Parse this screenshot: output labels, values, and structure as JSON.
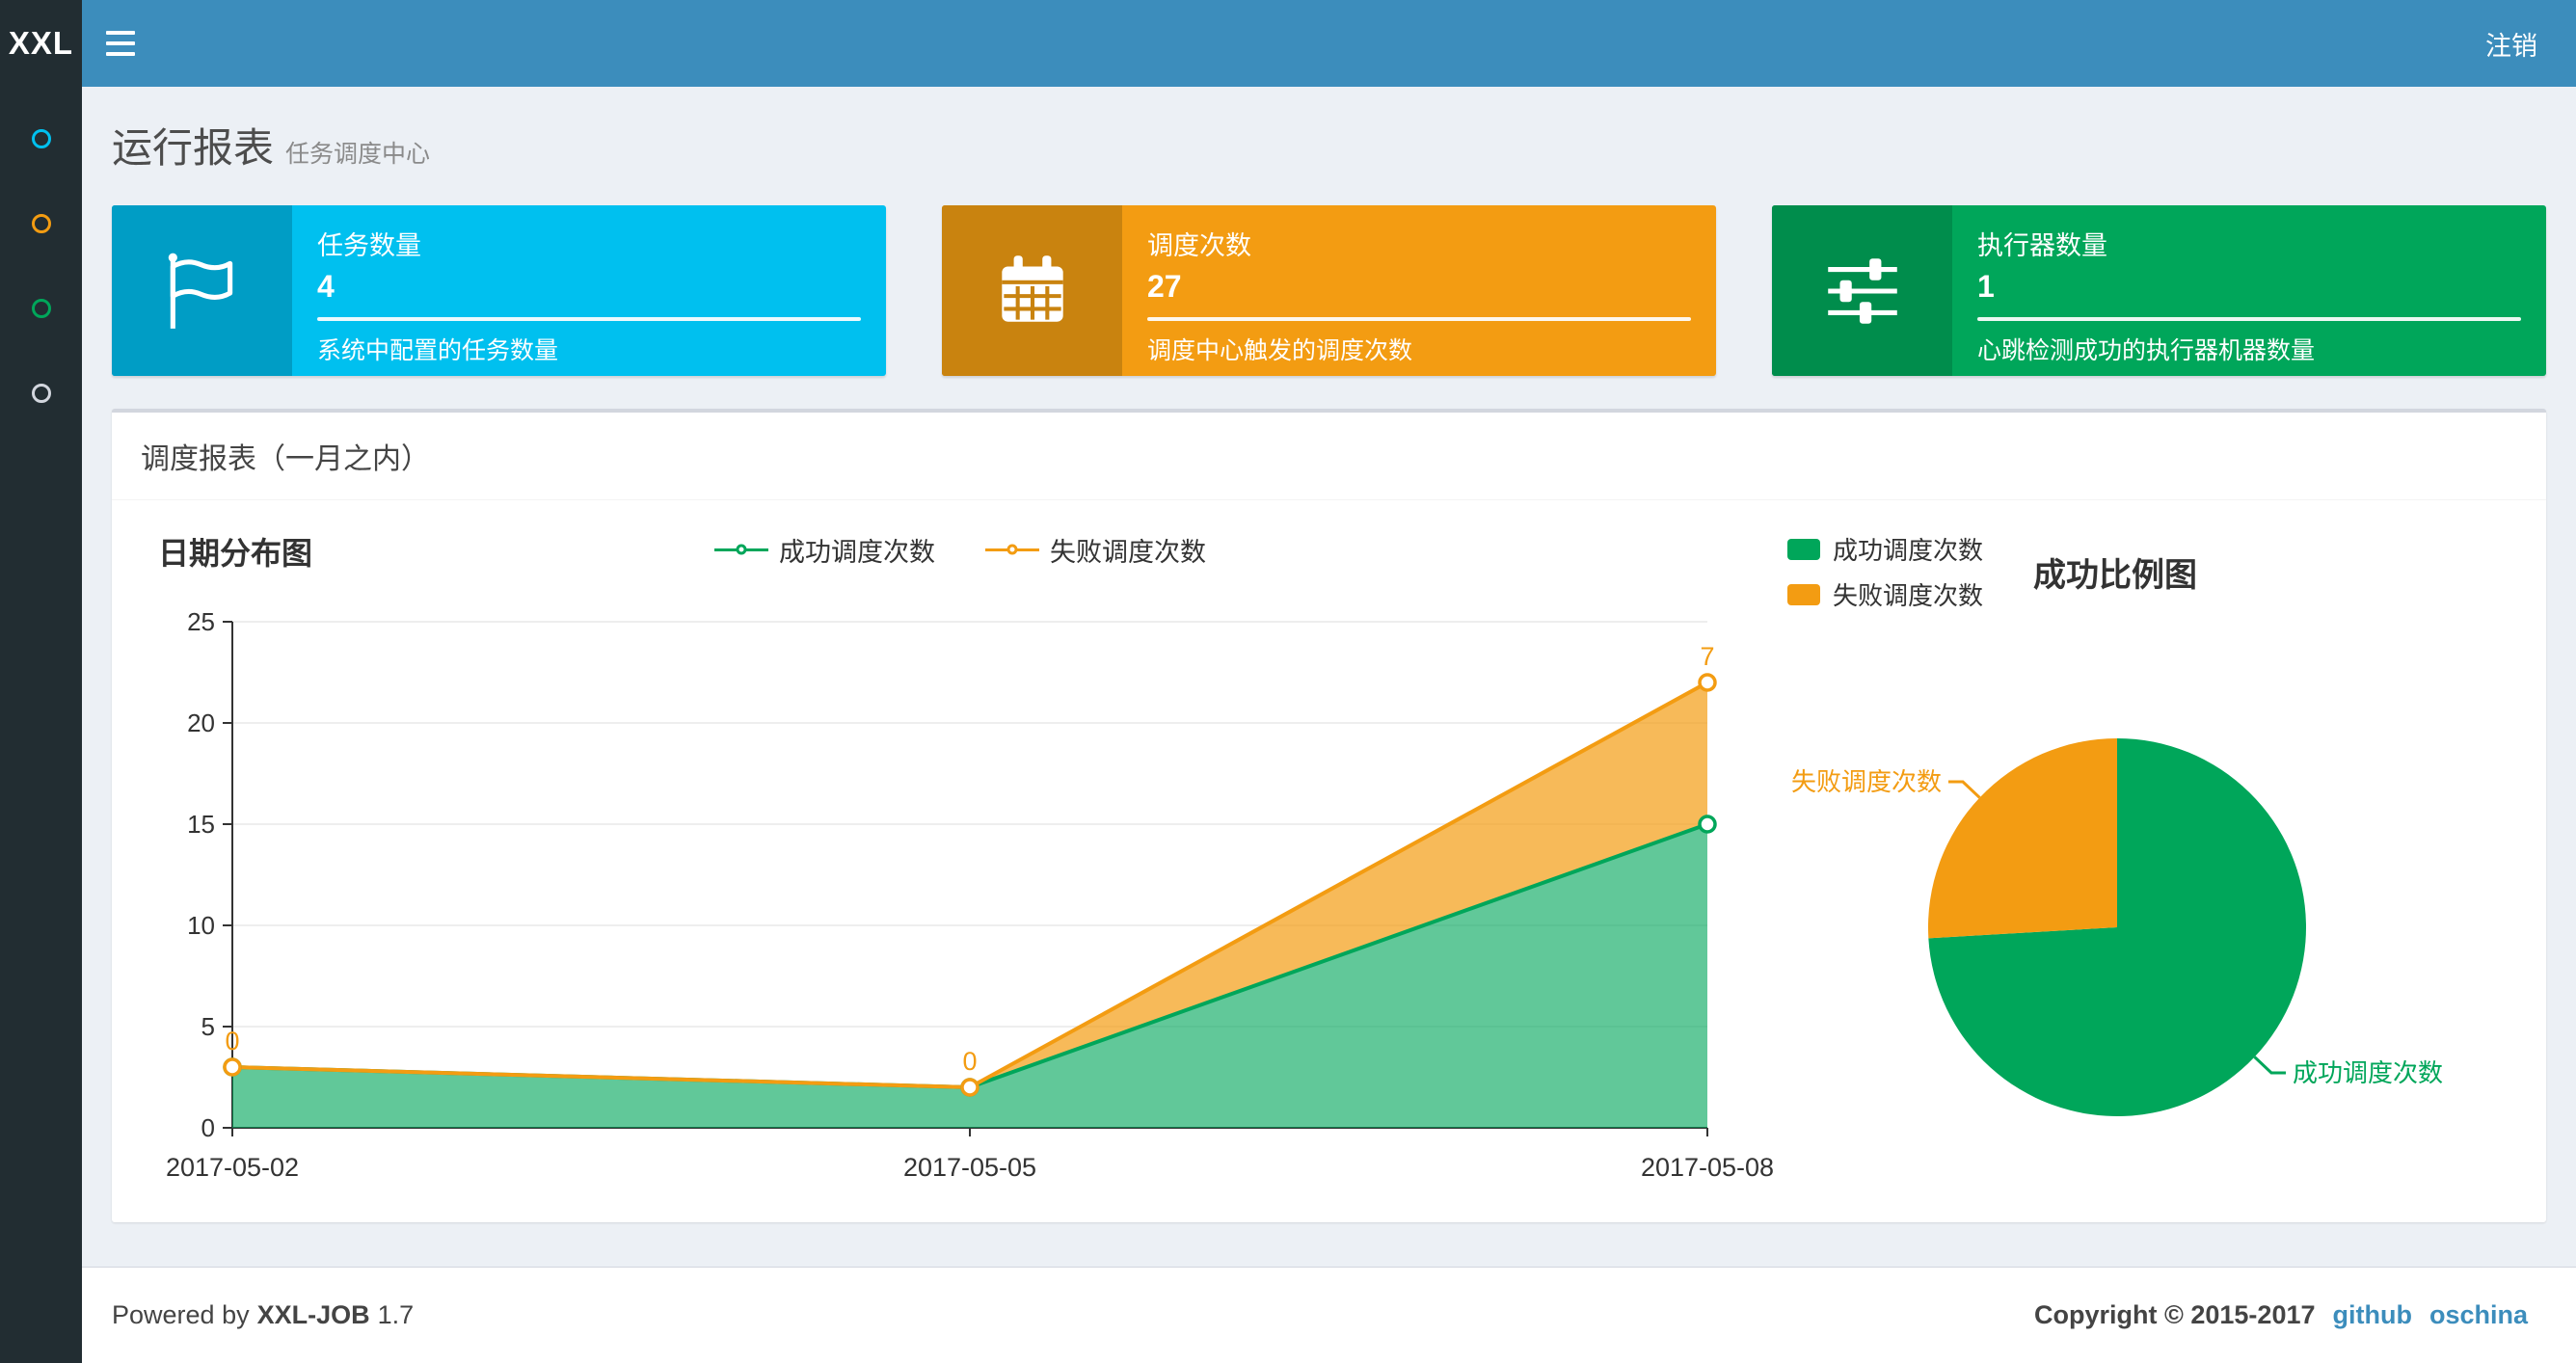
{
  "navbar": {
    "logo": "XXL",
    "logout_label": "注销"
  },
  "sidebar": {
    "items": [
      {
        "id": "menu-dot-1",
        "color": "#00c0ef"
      },
      {
        "id": "menu-dot-2",
        "color": "#f39c12"
      },
      {
        "id": "menu-dot-3",
        "color": "#00a65a"
      },
      {
        "id": "menu-dot-4",
        "color": "#d2d6de"
      }
    ]
  },
  "page_header": {
    "title": "运行报表",
    "subtitle": "任务调度中心"
  },
  "info_boxes": [
    {
      "icon": "flag-icon",
      "label": "任务数量",
      "value": "4",
      "desc": "系统中配置的任务数量",
      "bg": "#00c0ef",
      "icon_bg": "#009dc5"
    },
    {
      "icon": "calendar-icon",
      "label": "调度次数",
      "value": "27",
      "desc": "调度中心触发的调度次数",
      "bg": "#f39c12",
      "icon_bg": "#c9830f"
    },
    {
      "icon": "sliders-icon",
      "label": "执行器数量",
      "value": "1",
      "desc": "心跳检测成功的执行器机器数量",
      "bg": "#00a65a",
      "icon_bg": "#008d4c"
    }
  ],
  "panel": {
    "title": "调度报表（一月之内）"
  },
  "chart_data": [
    {
      "type": "area",
      "title": "日期分布图",
      "x": [
        "2017-05-02",
        "2017-05-05",
        "2017-05-08"
      ],
      "series": [
        {
          "name": "成功调度次数",
          "color": "#00a65a",
          "values": [
            3,
            2,
            15
          ]
        },
        {
          "name": "失败调度次数",
          "color": "#f39c12",
          "values": [
            0,
            0,
            7
          ]
        }
      ],
      "stacked": true,
      "point_labels": [
        0,
        0,
        7
      ],
      "ylim": [
        0,
        25
      ],
      "yticks": [
        0,
        5,
        10,
        15,
        20,
        25
      ],
      "legend_position": "top-center",
      "grid": "faint-horizontal"
    },
    {
      "type": "pie",
      "title": "成功比例图",
      "slices": [
        {
          "name": "成功调度次数",
          "value": 20,
          "color": "#00a65a"
        },
        {
          "name": "失败调度次数",
          "value": 7,
          "color": "#f39c12"
        }
      ],
      "legend": [
        "成功调度次数",
        "失败调度次数"
      ],
      "legend_position": "top-left"
    }
  ],
  "footer": {
    "powered_prefix": "Powered by",
    "product": "XXL-JOB",
    "version": "1.7",
    "copyright": "Copyright © 2015-2017",
    "links": [
      "github",
      "oschina"
    ]
  }
}
